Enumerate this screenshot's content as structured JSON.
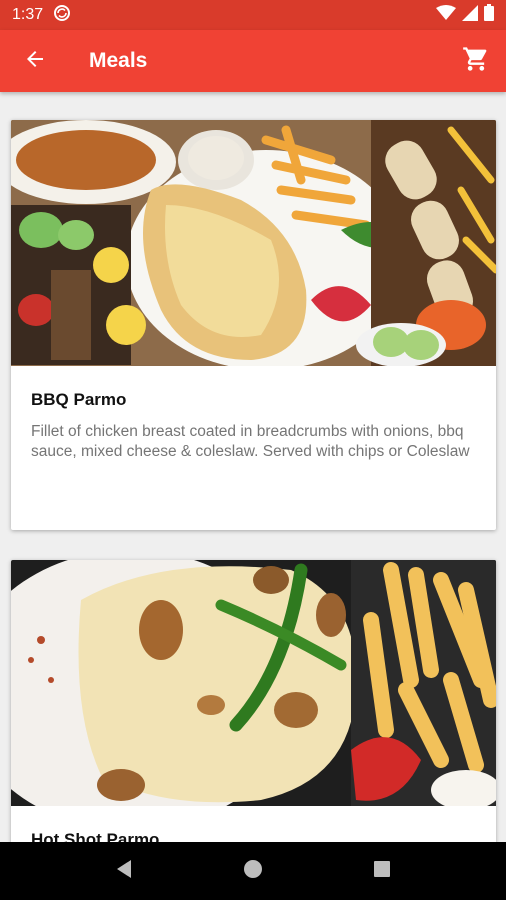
{
  "status_bar": {
    "time": "1:37",
    "icons": [
      "sync-blocked-icon",
      "wifi-icon",
      "signal-icon",
      "battery-icon"
    ]
  },
  "app_bar": {
    "title": "Meals",
    "back_icon": "arrow-back-icon",
    "cart_icon": "shopping-cart-icon",
    "color": "#f04234"
  },
  "meals": [
    {
      "title": "BBQ Parmo",
      "description": "Fillet of chicken breast coated in breadcrumbs with onions, bbq sauce, mixed cheese & coleslaw. Served with chips or Coleslaw"
    },
    {
      "title": "Hot Shot Parmo",
      "description": ""
    }
  ],
  "nav_bar": {
    "icons": [
      "back-triangle-icon",
      "home-circle-icon",
      "recents-square-icon"
    ]
  }
}
